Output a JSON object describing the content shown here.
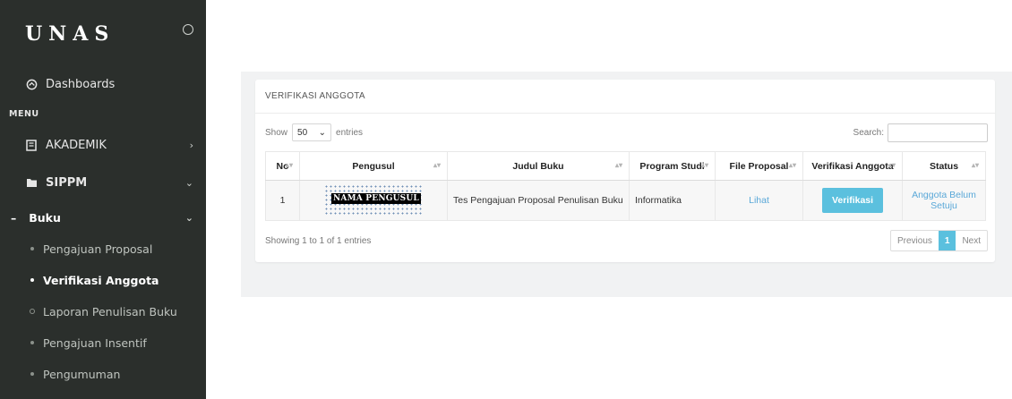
{
  "sidebar": {
    "logo": "UNAS",
    "dashboards": "Dashboards",
    "section_menu": "MENU",
    "akademik": "AKADEMIK",
    "sippm": "SIPPM",
    "buku": "Buku",
    "leaves": [
      "Pengajuan Proposal",
      "Verifikasi Anggota",
      "Laporan Penulisan Buku",
      "Pengajuan Insentif",
      "Pengumuman"
    ]
  },
  "card": {
    "title": "VERIFIKASI ANGGOTA",
    "show_label": "Show",
    "entries_value": "50",
    "entries_label": "entries",
    "search_label": "Search:",
    "columns": [
      "No",
      "Pengusul",
      "Judul Buku",
      "Program Studi",
      "File Proposal",
      "Verifikasi Anggota",
      "Status"
    ],
    "row": {
      "no": "1",
      "pengusul": "NAMA PENGUSUL",
      "judul": "Tes Pengajuan Proposal Penulisan Buku",
      "prodi": "Informatika",
      "file": "Lihat",
      "verif": "Verifikasi",
      "status": "Anggota Belum Setuju"
    },
    "info": "Showing 1 to 1 of 1 entries",
    "prev": "Previous",
    "page": "1",
    "next": "Next"
  },
  "colors": {
    "sidebar_bg": "#2b2f2c",
    "accent": "#5bc0de",
    "link": "#5aa8d8"
  }
}
